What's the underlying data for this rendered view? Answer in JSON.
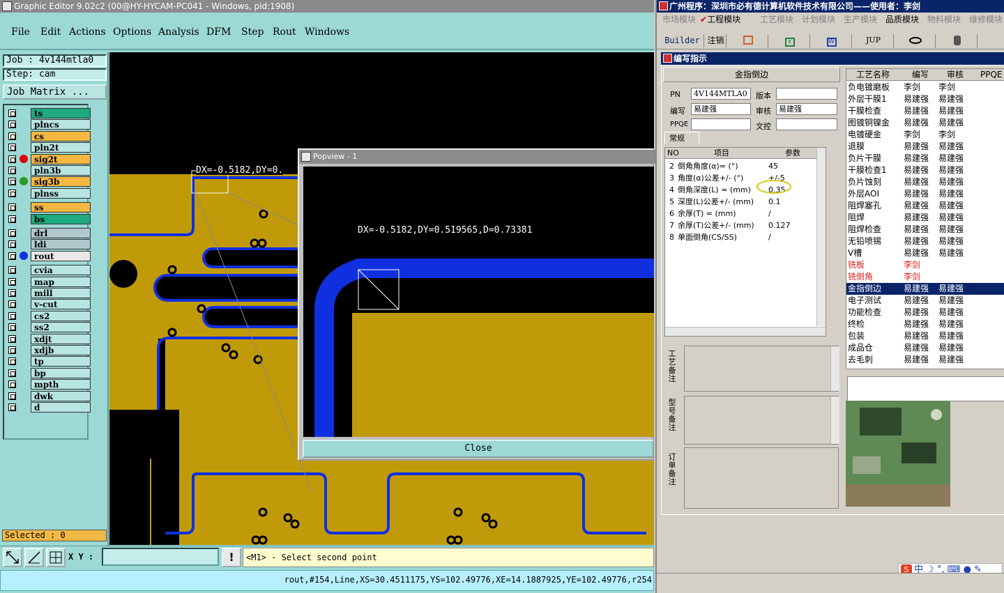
{
  "left_app": {
    "title": "Graphic Editor 9.02c2 (00@HY-HYCAM-PC041 - Windows, pid:1908)",
    "menu": [
      "File",
      "Edit",
      "Actions",
      "Options",
      "Analysis",
      "DFM",
      "Step",
      "Rout",
      "Windows"
    ],
    "job": "Job : 4v144mtla0",
    "step": "Step: cam",
    "job_matrix": "Job Matrix ...",
    "layers": [
      {
        "name": "ts",
        "color": "#1fa97e",
        "dot": ""
      },
      {
        "name": "plncs",
        "color": "#b8e4e1",
        "dot": ""
      },
      {
        "name": "cs",
        "color": "#f3b742",
        "dot": ""
      },
      {
        "name": "pln2t",
        "color": "#b8e4e1",
        "dot": ""
      },
      {
        "name": "sig2t",
        "color": "#f3b742",
        "dot": "#e00000"
      },
      {
        "name": "pln3b",
        "color": "#b8e4e1",
        "dot": ""
      },
      {
        "name": "sig3b",
        "color": "#f3b742",
        "dot": "#2a9a2a"
      },
      {
        "name": "plnss",
        "color": "#b8e4e1",
        "dot": ""
      },
      {
        "name": "ss",
        "color": "#f3b742",
        "dot": ""
      },
      {
        "name": "bs",
        "color": "#1fa97e",
        "dot": ""
      },
      {
        "name": "drl",
        "color": "#b0c8cc",
        "dot": ""
      },
      {
        "name": "ldi",
        "color": "#b0c8cc",
        "dot": ""
      },
      {
        "name": "rout",
        "color": "#e8e8e8",
        "dot": "#1030e0"
      },
      {
        "name": "cvia",
        "color": "#b8e4e1",
        "dot": ""
      },
      {
        "name": "map",
        "color": "#b8e4e1",
        "dot": ""
      },
      {
        "name": "mill",
        "color": "#b8e4e1",
        "dot": ""
      },
      {
        "name": "v-cut",
        "color": "#b8e4e1",
        "dot": ""
      },
      {
        "name": "cs2",
        "color": "#b8e4e1",
        "dot": ""
      },
      {
        "name": "ss2",
        "color": "#b8e4e1",
        "dot": ""
      },
      {
        "name": "xdjt",
        "color": "#b8e4e1",
        "dot": ""
      },
      {
        "name": "xdjb",
        "color": "#b8e4e1",
        "dot": ""
      },
      {
        "name": "tp",
        "color": "#b8e4e1",
        "dot": ""
      },
      {
        "name": "bp",
        "color": "#b8e4e1",
        "dot": ""
      },
      {
        "name": "mpth",
        "color": "#b8e4e1",
        "dot": ""
      },
      {
        "name": "dwk",
        "color": "#b8e4e1",
        "dot": ""
      },
      {
        "name": "d",
        "color": "#b8e4e1",
        "dot": ""
      }
    ],
    "selected": "Selected : 0",
    "canvas_measure_label": "DX=-0.5182,DY=0.",
    "popview": {
      "title": "Popview - 1",
      "measure": "DX=-0.5182,DY=0.519565,D=0.73381",
      "close": "Close"
    },
    "xy_label": "X Y :",
    "prompt": "<M1> - Select second point",
    "status_line": "rout,#154,Line,XS=30.4511175,YS=102.49776,XE=14.1887925,YE=102.49776,r254"
  },
  "right_app": {
    "title": "广州程序：深圳市必有德计算机软件技术有限公司——使用者：李剑",
    "modules": [
      "市场模块",
      "工程模块",
      "工艺模块",
      "计划模块",
      "生产模块",
      "品质模块",
      "物料模块",
      "维修模块"
    ],
    "toolbar": [
      "Builder",
      "注销",
      "JUP"
    ],
    "subtitle": "编写指示",
    "form_title": "金指倒边",
    "pn_label": "PN",
    "pn_value": "4V144MTLA0",
    "version_label": "版本",
    "version_value": "",
    "author_label": "编写",
    "author_value": "易建强",
    "reviewer_label": "审核",
    "reviewer_value": "易建强",
    "ppqe_label": "PPQE",
    "ppqe_value": "",
    "doc_label": "文控",
    "doc_value": "",
    "tab_normal": "常规",
    "param_headers": [
      "NO",
      "项目",
      "参数"
    ],
    "params": [
      {
        "no": "2",
        "item": "倒角角度(α)= (°)",
        "value": "45"
      },
      {
        "no": "3",
        "item": "角度(α)公差+/- (°)",
        "value": "+/-5"
      },
      {
        "no": "4",
        "item": "倒角深度(L) = (mm)",
        "value": "0.35"
      },
      {
        "no": "5",
        "item": "深度(L)公差+/- (mm)",
        "value": "0.1"
      },
      {
        "no": "6",
        "item": "余厚(T) = (mm)",
        "value": "/"
      },
      {
        "no": "7",
        "item": "余厚(T)公差+/- (mm)",
        "value": "0.127"
      },
      {
        "no": "8",
        "item": "单面倒角(CS/SS)",
        "value": "/"
      }
    ],
    "note_labels": [
      "工艺备注",
      "型号备注",
      "订单备注"
    ],
    "process_headers": [
      "工艺名称",
      "编写",
      "审核",
      "PPQE"
    ],
    "processes": [
      {
        "name": "负电镀磨板",
        "author": "李剑",
        "reviewer": "李剑",
        "red": false,
        "sel": false
      },
      {
        "name": "外层干膜1",
        "author": "易建强",
        "reviewer": "易建强",
        "red": false,
        "sel": false
      },
      {
        "name": "干膜检查",
        "author": "易建强",
        "reviewer": "易建强",
        "red": false,
        "sel": false
      },
      {
        "name": "图镀铜镍金",
        "author": "易建强",
        "reviewer": "易建强",
        "red": false,
        "sel": false
      },
      {
        "name": "电镀硬金",
        "author": "李剑",
        "reviewer": "李剑",
        "red": false,
        "sel": false
      },
      {
        "name": "退膜",
        "author": "易建强",
        "reviewer": "易建强",
        "red": false,
        "sel": false
      },
      {
        "name": "负片干膜",
        "author": "易建强",
        "reviewer": "易建强",
        "red": false,
        "sel": false
      },
      {
        "name": "干膜检查1",
        "author": "易建强",
        "reviewer": "易建强",
        "red": false,
        "sel": false
      },
      {
        "name": "负片蚀刻",
        "author": "易建强",
        "reviewer": "易建强",
        "red": false,
        "sel": false
      },
      {
        "name": "外层AOI",
        "author": "易建强",
        "reviewer": "易建强",
        "red": false,
        "sel": false
      },
      {
        "name": "阻焊塞孔",
        "author": "易建强",
        "reviewer": "易建强",
        "red": false,
        "sel": false
      },
      {
        "name": "阻焊",
        "author": "易建强",
        "reviewer": "易建强",
        "red": false,
        "sel": false
      },
      {
        "name": "阻焊检查",
        "author": "易建强",
        "reviewer": "易建强",
        "red": false,
        "sel": false
      },
      {
        "name": "无铅喷锡",
        "author": "易建强",
        "reviewer": "易建强",
        "red": false,
        "sel": false
      },
      {
        "name": "V槽",
        "author": "易建强",
        "reviewer": "易建强",
        "red": false,
        "sel": false
      },
      {
        "name": "铣板",
        "author": "李剑",
        "reviewer": "",
        "red": true,
        "sel": false
      },
      {
        "name": "铣倒角",
        "author": "李剑",
        "reviewer": "",
        "red": true,
        "sel": false
      },
      {
        "name": "金指倒边",
        "author": "易建强",
        "reviewer": "易建强",
        "red": false,
        "sel": true
      },
      {
        "name": "电子测试",
        "author": "易建强",
        "reviewer": "易建强",
        "red": false,
        "sel": false
      },
      {
        "name": "功能检查",
        "author": "易建强",
        "reviewer": "易建强",
        "red": false,
        "sel": false
      },
      {
        "name": "终检",
        "author": "易建强",
        "reviewer": "易建强",
        "red": false,
        "sel": false
      },
      {
        "name": "包装",
        "author": "易建强",
        "reviewer": "易建强",
        "red": false,
        "sel": false
      },
      {
        "name": "成品仓",
        "author": "易建强",
        "reviewer": "易建强",
        "red": false,
        "sel": false
      },
      {
        "name": "去毛刺",
        "author": "易建强",
        "reviewer": "易建强",
        "red": false,
        "sel": false
      }
    ],
    "ime_text": "中"
  }
}
